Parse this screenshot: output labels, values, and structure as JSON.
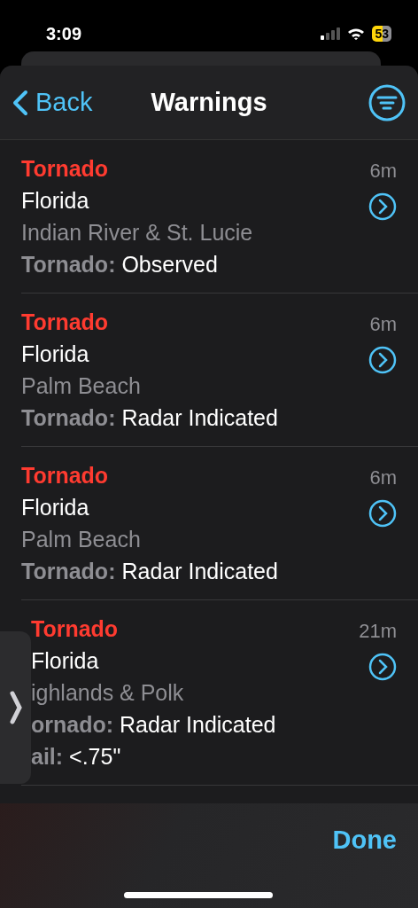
{
  "status_bar": {
    "time": "3:09",
    "battery": "53"
  },
  "nav": {
    "back": "Back",
    "title": "Warnings"
  },
  "warnings": [
    {
      "type": "Tornado",
      "time": "6m",
      "state": "Florida",
      "area": "Indian River & St. Lucie",
      "details": [
        {
          "label": "Tornado:",
          "value": "Observed"
        }
      ]
    },
    {
      "type": "Tornado",
      "time": "6m",
      "state": "Florida",
      "area": "Palm Beach",
      "details": [
        {
          "label": "Tornado:",
          "value": "Radar Indicated"
        }
      ]
    },
    {
      "type": "Tornado",
      "time": "6m",
      "state": "Florida",
      "area": "Palm Beach",
      "details": [
        {
          "label": "Tornado:",
          "value": "Radar Indicated"
        }
      ]
    },
    {
      "type": "Tornado",
      "time": "21m",
      "state": "Florida",
      "area": "ighlands & Polk",
      "details": [
        {
          "label": "ornado:",
          "value": "Radar Indicated"
        },
        {
          "label": "ail:",
          "value": "<.75\""
        }
      ]
    }
  ],
  "toolbar": {
    "done": "Done"
  }
}
